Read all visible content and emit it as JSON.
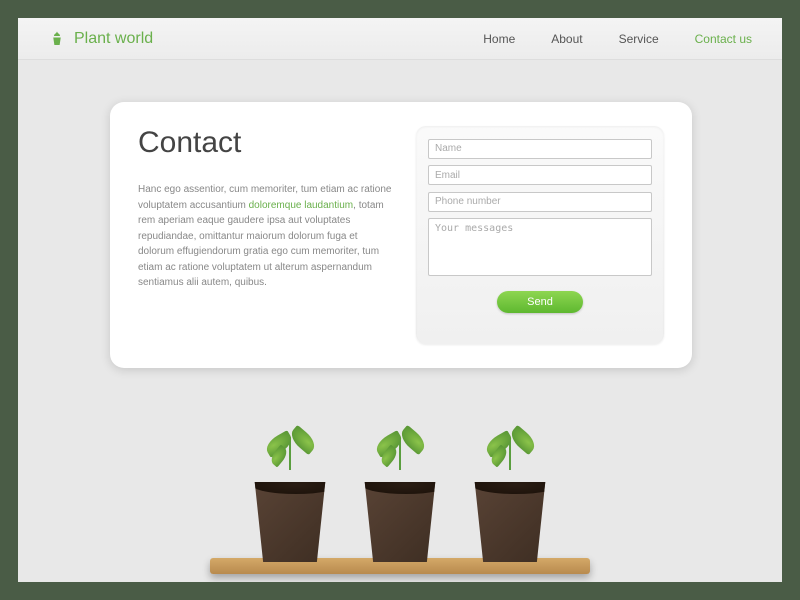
{
  "header": {
    "brand": "Plant world",
    "nav": [
      "Home",
      "About",
      "Service",
      "Contact us"
    ],
    "active_index": 3
  },
  "contact": {
    "title": "Contact",
    "desc_pre": "Hanc ego assentior, cum memoriter, tum etiam ac ratione voluptatem accusantium ",
    "desc_highlight": "doloremque laudantium",
    "desc_post": ", totam rem aperiam eaque gaudere ipsa aut voluptates repudiandae, omittantur maiorum dolorum fuga et dolorum effugiendorum gratia  ego cum memoriter, tum etiam ac ratione voluptatem ut alterum aspernandum sentiamus alii autem, quibus."
  },
  "form": {
    "name_ph": "Name",
    "email_ph": "Email",
    "phone_ph": "Phone number",
    "message_ph": "Your messages",
    "send_label": "Send"
  }
}
